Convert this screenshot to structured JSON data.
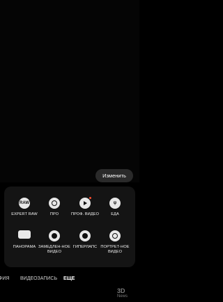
{
  "edit_button": "Изменить",
  "modes": [
    {
      "label": "EXPERT RAW",
      "icon": "raw-icon",
      "icon_text": "RAW"
    },
    {
      "label": "ПРО",
      "icon": "aperture-icon"
    },
    {
      "label": "ПРОФ. ВИДЕО",
      "icon": "play-icon",
      "has_badge": true
    },
    {
      "label": "ЕДА",
      "icon": "food-icon"
    },
    {
      "label": "ПАНОРАМА",
      "icon": "panorama-icon"
    },
    {
      "label": "ЗАМЕДЛЕН-НОЕ ВИДЕО",
      "icon": "slow-motion-icon"
    },
    {
      "label": "ГИПЕРЛАПС",
      "icon": "hyperlapse-icon"
    },
    {
      "label": "ПОРТРЕТ-НОЕ ВИДЕО",
      "icon": "portrait-video-icon"
    }
  ],
  "tabs": [
    {
      "label": "ФИЯ"
    },
    {
      "label": "ВИДЕОЗАПИСЬ"
    },
    {
      "label": "ЕЩЕ",
      "active": true
    }
  ],
  "watermark": {
    "line1": "3D",
    "line2": "News"
  },
  "colors": {
    "background": "#000000",
    "panel": "#141414",
    "badge": "#ff4d2e"
  }
}
